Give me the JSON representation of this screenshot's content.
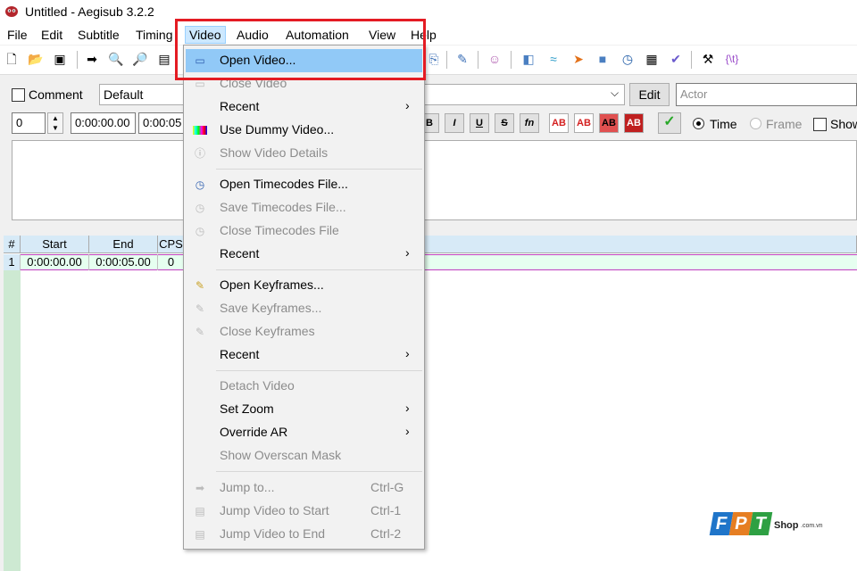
{
  "window": {
    "title": "Untitled - Aegisub 3.2.2"
  },
  "menubar": [
    "File",
    "Edit",
    "Subtitle",
    "Timing",
    "Video",
    "Audio",
    "Automation",
    "View",
    "Help"
  ],
  "edit_panel": {
    "comment_label": "Comment",
    "style_value": "Default",
    "edit_button": "Edit",
    "actor_placeholder": "Actor",
    "layer_value": "0",
    "start_time": "0:00:00.00",
    "end_time": "0:00:05",
    "format_buttons": [
      "B",
      "I",
      "U",
      "S",
      "fn",
      "AB",
      "AB",
      "AB",
      "AB"
    ],
    "time_label": "Time",
    "frame_label": "Frame",
    "show_label": "Show"
  },
  "grid": {
    "headers": [
      "#",
      "Start",
      "End",
      "CPS"
    ],
    "rows": [
      {
        "num": "1",
        "start": "0:00:00.00",
        "end": "0:00:05.00",
        "cps": "0"
      }
    ]
  },
  "video_menu": {
    "items": [
      {
        "label": "Open Video...",
        "enabled": true,
        "highlighted": true,
        "icon": "open-video-icon"
      },
      {
        "label": "Close Video",
        "enabled": false,
        "icon": "close-video-icon"
      },
      {
        "label": "Recent",
        "enabled": true,
        "submenu": true
      },
      {
        "label": "Use Dummy Video...",
        "enabled": true,
        "icon": "dummy-video-icon"
      },
      {
        "label": "Show Video Details",
        "enabled": false,
        "icon": "video-details-icon"
      },
      {
        "label": "Open Timecodes File...",
        "enabled": true,
        "icon": "open-timecodes-icon"
      },
      {
        "label": "Save Timecodes File...",
        "enabled": false,
        "icon": "save-timecodes-icon"
      },
      {
        "label": "Close Timecodes File",
        "enabled": false,
        "icon": "close-timecodes-icon"
      },
      {
        "label": "Recent",
        "enabled": true,
        "submenu": true
      },
      {
        "label": "Open Keyframes...",
        "enabled": true,
        "icon": "open-keyframes-icon"
      },
      {
        "label": "Save Keyframes...",
        "enabled": false,
        "icon": "save-keyframes-icon"
      },
      {
        "label": "Close Keyframes",
        "enabled": false,
        "icon": "close-keyframes-icon"
      },
      {
        "label": "Recent",
        "enabled": true,
        "submenu": true
      },
      {
        "label": "Detach Video",
        "enabled": false
      },
      {
        "label": "Set Zoom",
        "enabled": true,
        "submenu": true
      },
      {
        "label": "Override AR",
        "enabled": true,
        "submenu": true
      },
      {
        "label": "Show Overscan Mask",
        "enabled": false
      },
      {
        "label": "Jump to...",
        "enabled": false,
        "shortcut": "Ctrl-G",
        "icon": "jump-to-icon"
      },
      {
        "label": "Jump Video to Start",
        "enabled": false,
        "shortcut": "Ctrl-1",
        "icon": "jump-start-icon"
      },
      {
        "label": "Jump Video to End",
        "enabled": false,
        "shortcut": "Ctrl-2",
        "icon": "jump-end-icon"
      }
    ]
  },
  "watermark": {
    "brand": "FPT",
    "suffix": "Shop",
    "domain": ".com.vn"
  },
  "colors": {
    "highlight_box": "#e41b23",
    "menu_highlight": "#91c9f7",
    "grid_header": "#d7eaf7",
    "selected_row": "#e6fff0"
  }
}
